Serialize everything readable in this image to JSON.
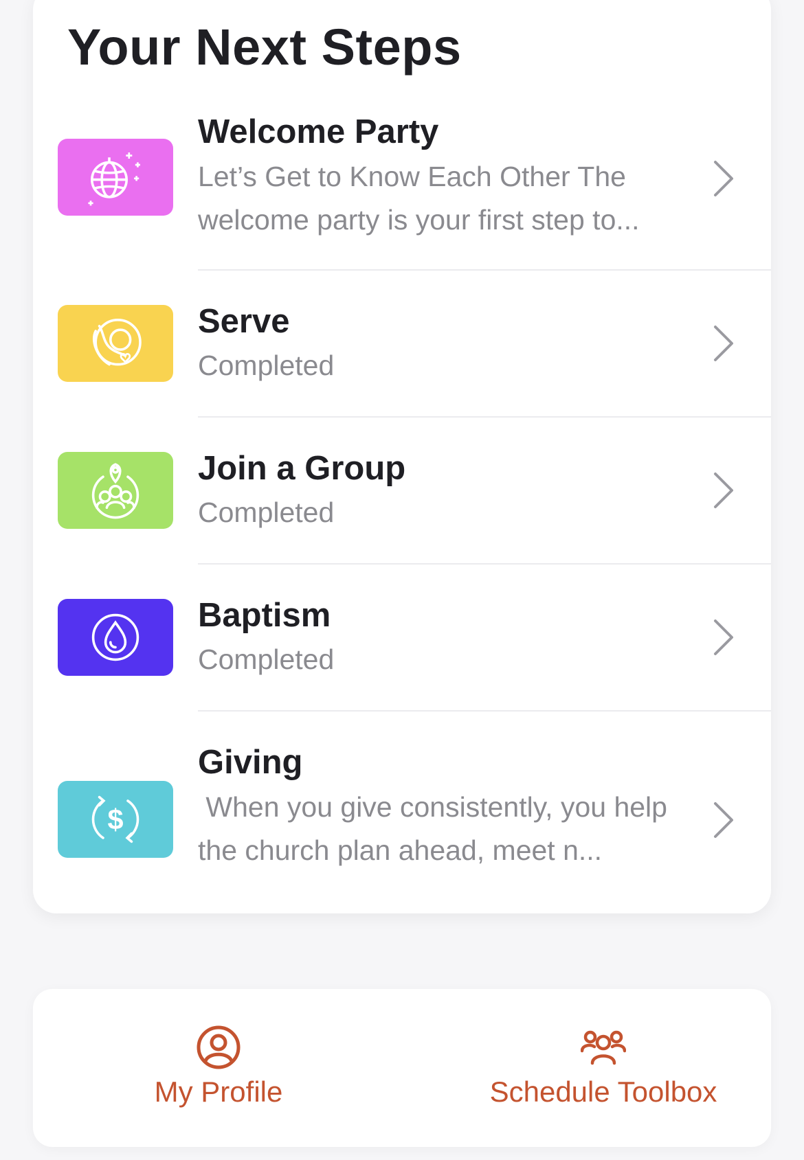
{
  "next_steps": {
    "title": "Your Next Steps",
    "items": [
      {
        "title": "Welcome Party",
        "subtitle": "Let’s Get to Know Each Other The welcome party is your first step to...",
        "icon": "disco-ball-icon",
        "color": "#ea6ff0"
      },
      {
        "title": "Serve",
        "subtitle": "Completed",
        "icon": "serving-hand-icon",
        "color": "#f9d350"
      },
      {
        "title": "Join a Group",
        "subtitle": "Completed",
        "icon": "group-location-icon",
        "color": "#a6e268"
      },
      {
        "title": "Baptism",
        "subtitle": "Completed",
        "icon": "water-drop-icon",
        "color": "#5433f0"
      },
      {
        "title": "Giving",
        "subtitle": " When you give consistently, you help the church plan ahead, meet n...",
        "icon": "dollar-cycle-icon",
        "color": "#5fcbd9"
      }
    ]
  },
  "actions": {
    "accent_color": "#c4532f",
    "my_profile": {
      "label": "My Profile",
      "icon": "profile-icon"
    },
    "schedule_toolbox": {
      "label": "Schedule Toolbox",
      "icon": "team-icon"
    }
  }
}
